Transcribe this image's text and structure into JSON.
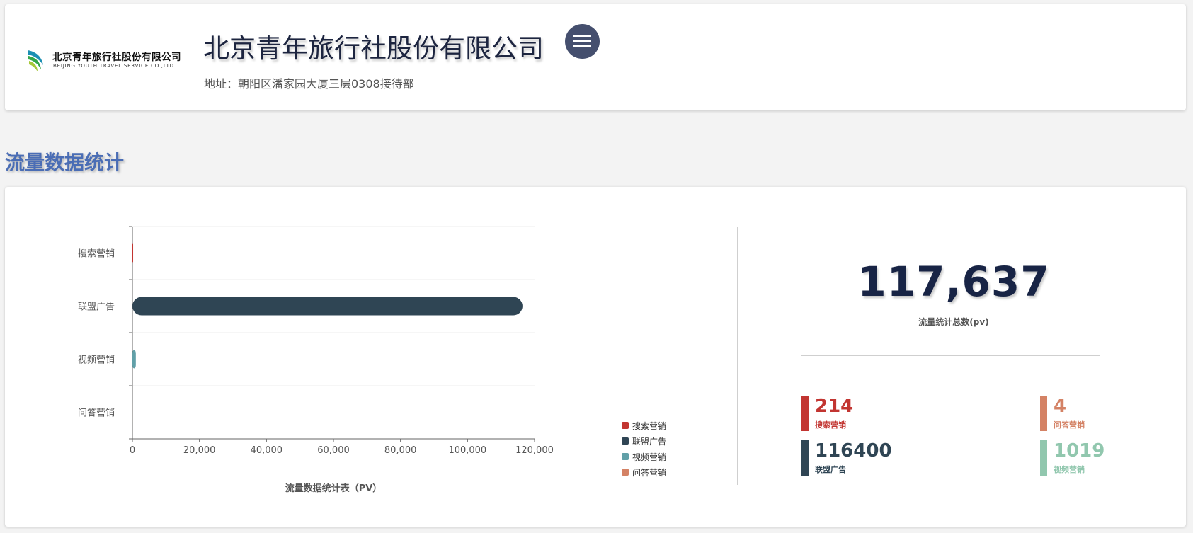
{
  "header": {
    "logo_cn": "北京青年旅行社股份有限公司",
    "logo_en": "BEIJING YOUTH TRAVEL SERVICE CO.,LTD.",
    "company_name": "北京青年旅行社股份有限公司",
    "address": "地址：朝阳区潘家园大厦三层0308接待部",
    "menu_icon": "hamburger-menu-icon"
  },
  "section_title": "流量数据统计",
  "summary": {
    "total_value": "117,637",
    "total_label": "流量统计总数(pv)",
    "items": [
      {
        "value": "214",
        "label": "搜索营销",
        "color": "#c23531"
      },
      {
        "value": "4",
        "label": "问答营销",
        "color": "#d48265"
      },
      {
        "value": "116400",
        "label": "联盟广告",
        "color": "#2f4554"
      },
      {
        "value": "1019",
        "label": "视频营销",
        "color": "#91c7ae"
      }
    ]
  },
  "chart_data": {
    "type": "bar",
    "orientation": "horizontal",
    "categories": [
      "搜索营销",
      "联盟广告",
      "视频营销",
      "问答营销"
    ],
    "values": [
      214,
      116400,
      1019,
      4
    ],
    "colors": [
      "#c23531",
      "#2f4554",
      "#61a0a8",
      "#d48265"
    ],
    "xlim": [
      0,
      120000
    ],
    "xticks": [
      "0",
      "20,000",
      "40,000",
      "60,000",
      "80,000",
      "100,000",
      "120,000"
    ],
    "xlabel": "流量数据统计表（PV）",
    "legend": [
      "搜索营销",
      "联盟广告",
      "视频营销",
      "问答营销"
    ],
    "legend_position": "bottom-right",
    "grid": true
  }
}
